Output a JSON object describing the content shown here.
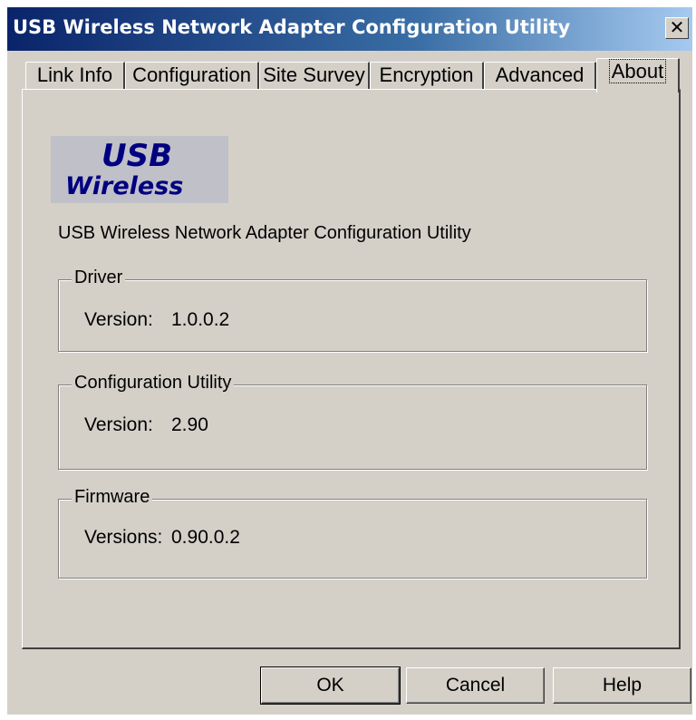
{
  "window": {
    "title": "USB Wireless Network Adapter Configuration Utility",
    "close_glyph": "✕"
  },
  "tabs": [
    {
      "label": "Link Info"
    },
    {
      "label": "Configuration"
    },
    {
      "label": "Site Survey"
    },
    {
      "label": "Encryption"
    },
    {
      "label": "Advanced"
    },
    {
      "label": "About",
      "active": true
    }
  ],
  "logo": {
    "line1": "USB",
    "line2": "Wireless"
  },
  "about": {
    "description": "USB Wireless Network Adapter Configuration Utility",
    "driver": {
      "title": "Driver",
      "label": "Version:",
      "value": "1.0.0.2"
    },
    "utility": {
      "title": "Configuration Utility",
      "label": "Version:",
      "value": "2.90"
    },
    "firmware": {
      "title": "Firmware",
      "label": "Versions:",
      "value": "0.90.0.2"
    }
  },
  "buttons": {
    "ok": "OK",
    "cancel": "Cancel",
    "help": "Help"
  },
  "colors": {
    "titlebar": "#0a246a",
    "face": "#d4d0c8",
    "logo_text": "#000080"
  }
}
